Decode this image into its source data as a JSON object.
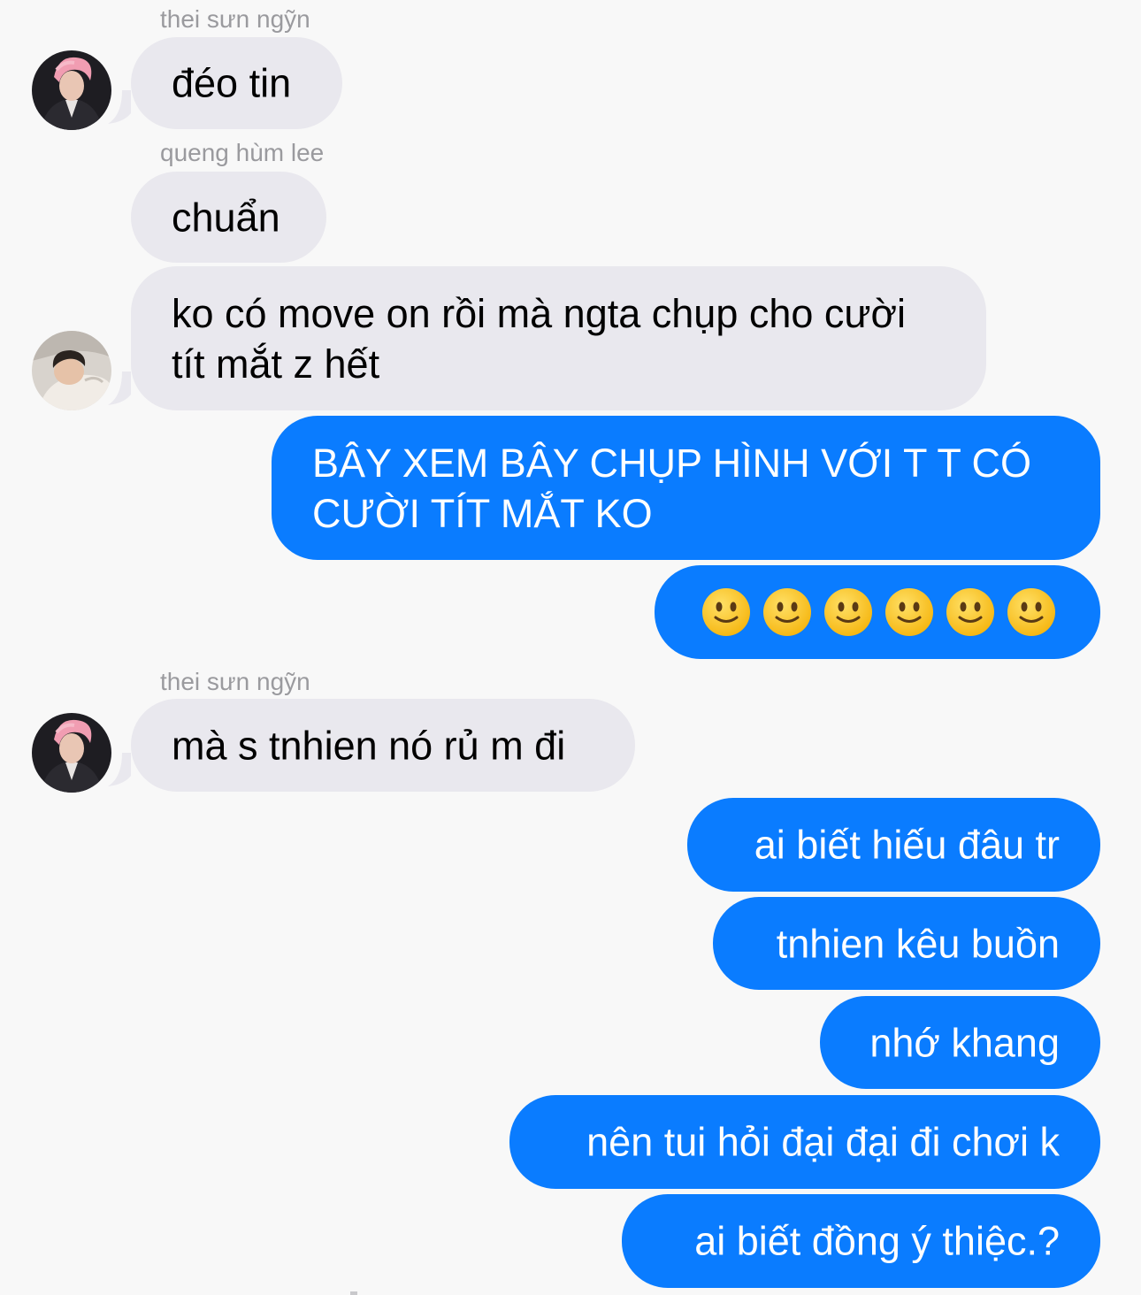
{
  "colors": {
    "background": "#f8f8f8",
    "incoming_bubble": "#e9e8ee",
    "outgoing_bubble": "#0a7cff",
    "sender_name": "#9a9a9e"
  },
  "messages": [
    {
      "direction": "incoming",
      "sender": "thei sưn ngỹn",
      "avatar": "avatar-pink-hair",
      "text": "đéo tin"
    },
    {
      "direction": "incoming",
      "sender": "queng hùm lee",
      "text": "chuẩn"
    },
    {
      "direction": "incoming",
      "avatar": "avatar-lying-down",
      "lines": [
        "ko có move on rồi mà ngta chụp cho cười",
        "tít mắt z hết"
      ]
    },
    {
      "direction": "outgoing",
      "lines": [
        "BÂY XEM BÂY CHỤP HÌNH VỚI T T CÓ",
        "CƯỜI TÍT MẮT KO"
      ]
    },
    {
      "direction": "outgoing",
      "emoji": "slightly-smiling-face-icon",
      "emoji_count": 6
    },
    {
      "direction": "incoming",
      "sender": "thei sưn ngỹn",
      "avatar": "avatar-pink-hair",
      "text": "mà s tnhien nó rủ m đi"
    },
    {
      "direction": "outgoing",
      "text": "ai biết hiếu đâu tr"
    },
    {
      "direction": "outgoing",
      "text": "tnhien kêu buồn"
    },
    {
      "direction": "outgoing",
      "text": "nhớ khang"
    },
    {
      "direction": "outgoing",
      "text": "nên tui hỏi đại đại đi chơi k"
    },
    {
      "direction": "outgoing",
      "text": "ai biết đồng ý thiệc.?"
    }
  ]
}
